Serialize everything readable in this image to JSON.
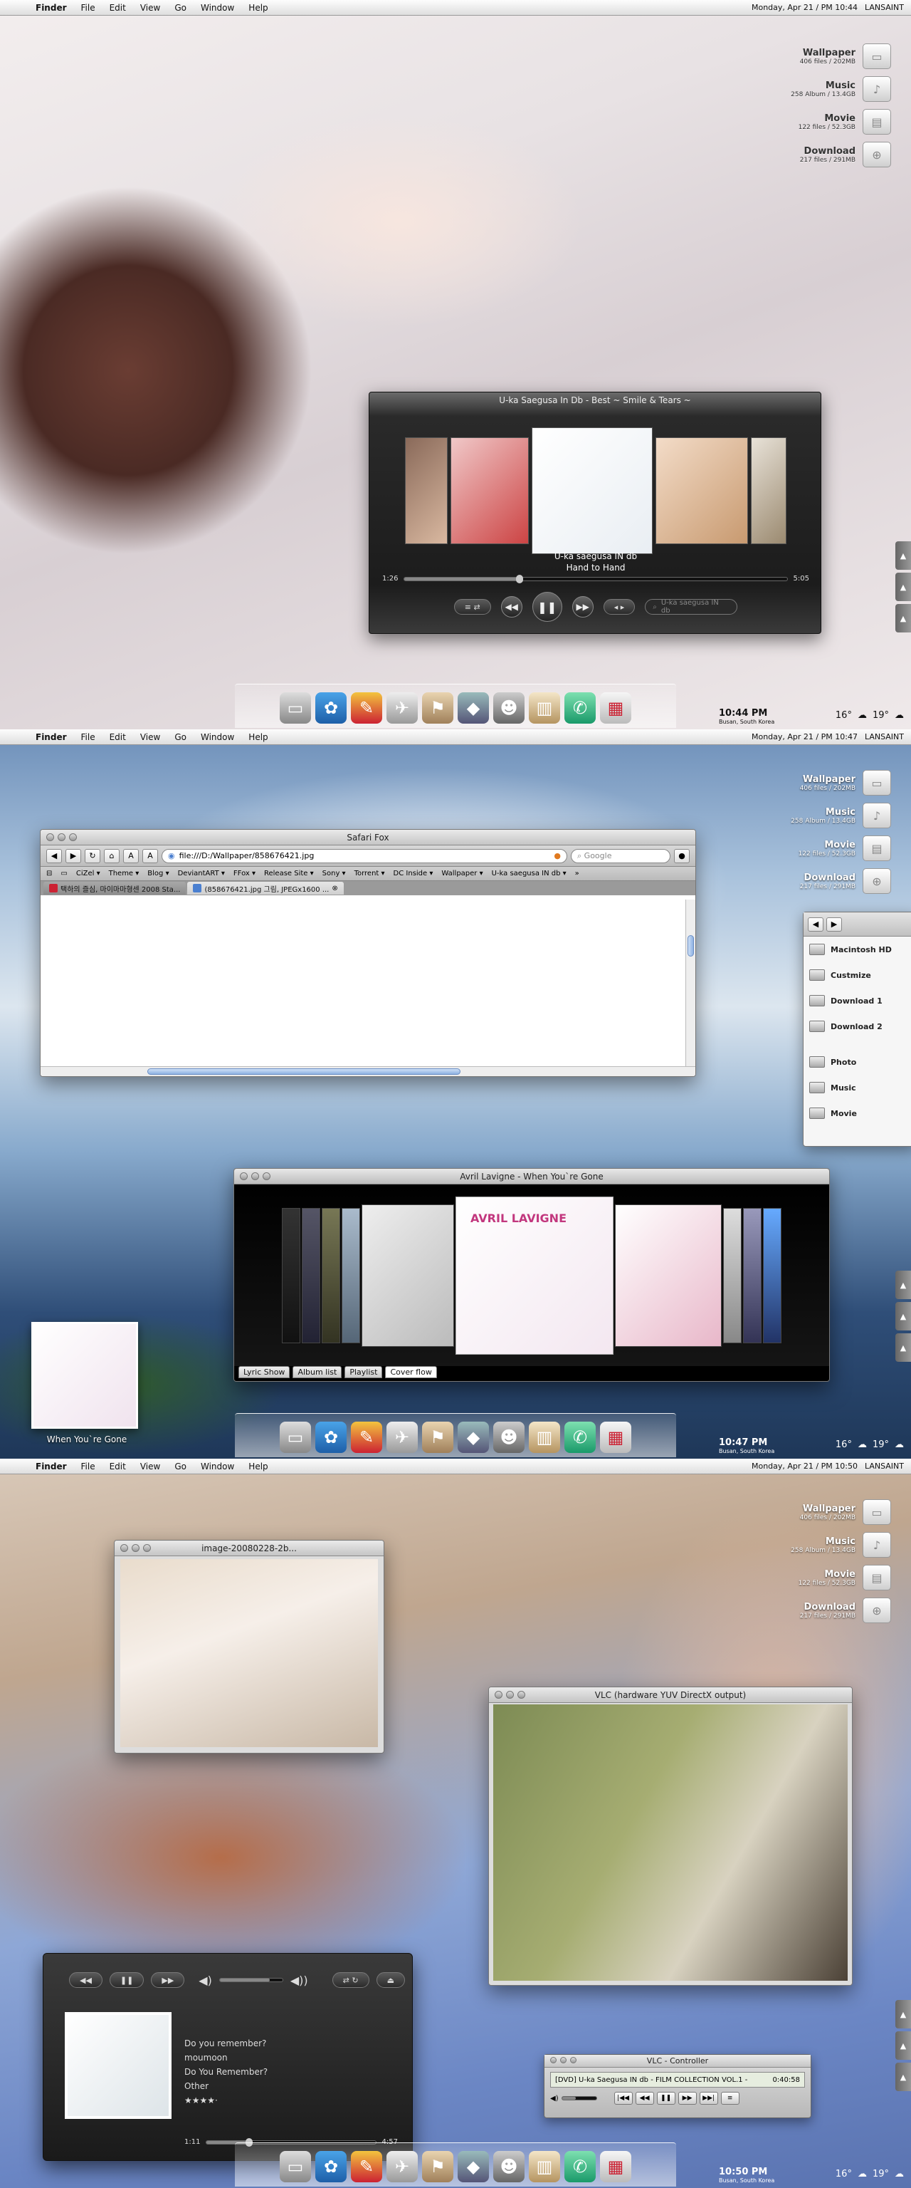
{
  "menubar": {
    "app": "Finder",
    "items": [
      "File",
      "Edit",
      "View",
      "Go",
      "Window",
      "Help"
    ],
    "owner": "LANSAINT"
  },
  "screens": [
    {
      "clock_full": "Monday, Apr 21 / PM 10:44",
      "clock_time": "10:44 PM",
      "location": "Busan, South Korea",
      "temps": [
        "16°",
        "19°"
      ]
    },
    {
      "clock_full": "Monday, Apr 21 / PM 10:47",
      "clock_time": "10:47 PM",
      "location": "Busan, South Korea",
      "temps": [
        "16°",
        "19°"
      ]
    },
    {
      "clock_full": "Monday, Apr 21 / PM 10:50",
      "clock_time": "10:50 PM",
      "location": "Busan, South Korea",
      "temps": [
        "16°",
        "19°"
      ]
    }
  ],
  "shelf": [
    {
      "title": "Wallpaper",
      "sub": "406 files / 202MB"
    },
    {
      "title": "Music",
      "sub": "258 Album / 13.4GB"
    },
    {
      "title": "Movie",
      "sub": "122 files / 52.3GB"
    },
    {
      "title": "Download",
      "sub": "217 files / 291MB"
    }
  ],
  "player1": {
    "title": "U-ka Saegusa In Db - Best ~ Smile & Tears ~",
    "artist": "U-ka saegusa IN db",
    "track": "Hand to Hand",
    "elapsed": "1:26",
    "remaining": "5:05",
    "progress": 0.3,
    "search_placeholder": "U-ka saegusa IN db"
  },
  "safari": {
    "title": "Safari Fox",
    "url": "file:///D:/Wallpaper/858676421.jpg",
    "search_placeholder": "Google",
    "bookmarks": [
      "CiZel ▾",
      "Theme ▾",
      "Blog ▾",
      "DeviantART ▾",
      "FFox ▾",
      "Release Site ▾",
      "Sony ▾",
      "Torrent ▾",
      "DC Inside ▾",
      "Wallpaper ▾",
      "U-ka saegusa IN db ▾",
      "»"
    ],
    "tabs": [
      "택하의 즐심, 마이마마형센 2008 Sta...",
      "(858676421.jpg 그림, JPEGx1600 ..."
    ]
  },
  "finder": {
    "items": [
      "Macintosh HD",
      "Custmize",
      "Download 1",
      "Download 2",
      "Photo",
      "Music",
      "Movie"
    ]
  },
  "coverflow": {
    "title": "Avril Lavigne - When You`re Gone",
    "tabs": [
      "Lyric Show",
      "Album list",
      "Playlist",
      "Cover flow"
    ],
    "caption": "When You`re Gone",
    "main_art": "AVRIL LAVIGNE"
  },
  "imgviewer": {
    "title": "image-20080228-2b..."
  },
  "vlc": {
    "title": "VLC (hardware YUV DirectX output)"
  },
  "player3": {
    "lines": [
      "Do you remember?",
      "moumoon",
      "Do You Remember?",
      "Other",
      "★★★★·"
    ],
    "elapsed": "1:11",
    "remaining": "4:57",
    "progress": 0.25
  },
  "vlcctrl": {
    "title": "VLC - Controller",
    "info": "[DVD] U-ka Saegusa IN db - FILM COLLECTION VOL.1 -",
    "time": "0:40:58"
  },
  "colors": {
    "accent": "#8eb2e3",
    "dark": "#1c1c1c"
  }
}
